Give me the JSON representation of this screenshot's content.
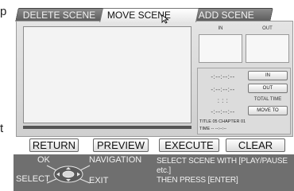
{
  "edge_left_top": "p",
  "edge_left_mid": "t",
  "tabs": [
    {
      "label": "DELETE SCENE",
      "active": false
    },
    {
      "label": "MOVE SCENE",
      "active": true
    },
    {
      "label": "ADD SCENE",
      "active": false
    }
  ],
  "thumbs": {
    "in_label": "IN",
    "out_label": "OUT"
  },
  "times": {
    "in_time": "-:--:--:--",
    "out_time": "-:--:--:--",
    "total_time": ":  :  :",
    "moveto_time": "-:--:--:--",
    "in_button": "IN",
    "out_button": "OUT",
    "total_label": "TOTAL TIME",
    "moveto_button": "MOVE TO",
    "title_chapter": "TITLE 05 CHAPTER 01",
    "time_line": "TIME -- --:--:--"
  },
  "actions": {
    "return": "RETURN",
    "preview": "PREVIEW",
    "execute": "EXECUTE",
    "clear": "CLEAR"
  },
  "nav": {
    "ok": "OK",
    "navigation": "NAVIGATION",
    "select": "SELECT",
    "exit": "EXIT"
  },
  "help": {
    "line1": "SELECT SCENE WITH [PLAY/PAUSE etc.]",
    "line2": "THEN PRESS [ENTER]"
  }
}
